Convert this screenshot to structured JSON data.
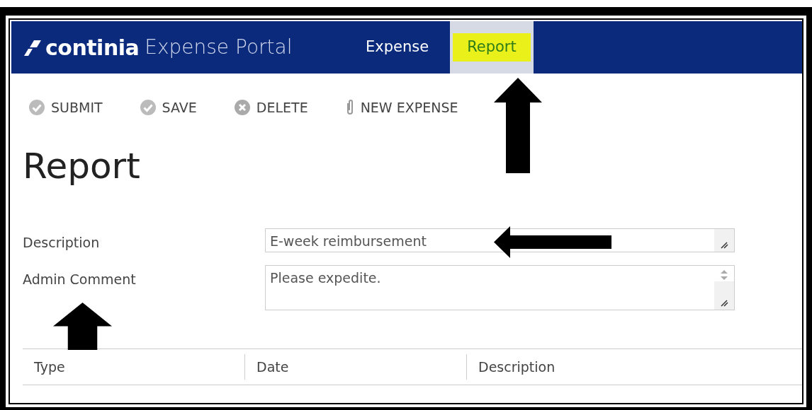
{
  "header": {
    "logo_brand": "continia",
    "logo_product": "Expense Portal"
  },
  "tabs": [
    {
      "label": "Expense",
      "selected": false,
      "highlighted": false
    },
    {
      "label": "Report",
      "selected": true,
      "highlighted": true
    }
  ],
  "toolbar": [
    {
      "label": "SUBMIT",
      "kind": "check"
    },
    {
      "label": "SAVE",
      "kind": "check"
    },
    {
      "label": "DELETE",
      "kind": "cross"
    },
    {
      "label": "NEW EXPENSE",
      "kind": "clip"
    }
  ],
  "page_title": "Report",
  "fields": [
    {
      "label": "Description",
      "value": "E-week reimbursement",
      "kind": "single"
    },
    {
      "label": "Admin Comment",
      "value": "Please expedite.",
      "kind": "multi"
    }
  ],
  "table": {
    "columns": [
      "Type",
      "Date",
      "Description"
    ]
  },
  "annotation_arrows": [
    {
      "kind": "up"
    },
    {
      "kind": "left"
    },
    {
      "kind": "up"
    }
  ]
}
